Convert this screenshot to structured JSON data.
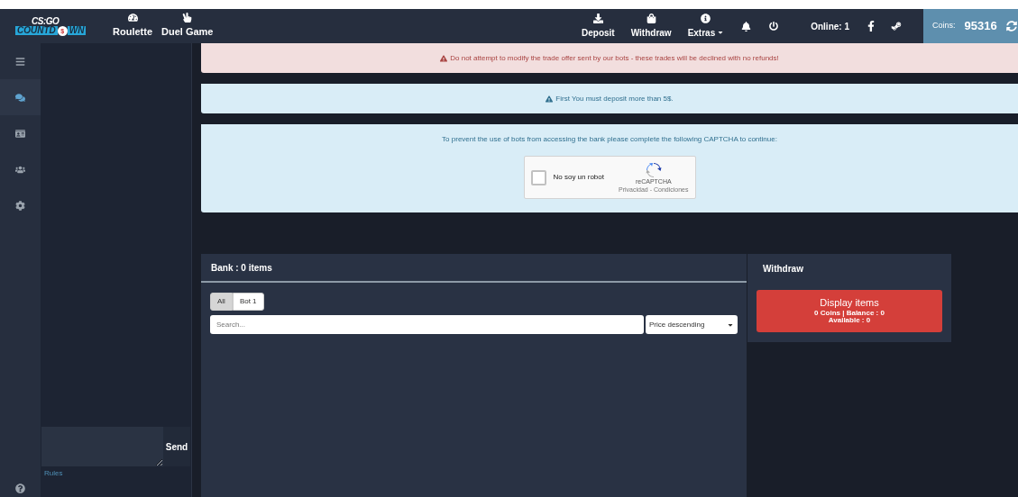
{
  "logo": {
    "top": "CS:GO",
    "left": "COUNTD",
    "coin": "$",
    "right": "WN"
  },
  "nav_left": [
    {
      "label": "Roulette"
    },
    {
      "label": "Duel Game"
    }
  ],
  "nav_right": [
    {
      "label": "Deposit"
    },
    {
      "label": "Withdraw"
    },
    {
      "label": "Extras",
      "dropdown": true
    }
  ],
  "online": {
    "label": "Online:",
    "count": "1"
  },
  "coins": {
    "label": "Coins:",
    "value": "95316"
  },
  "rail": [
    {
      "selected": false
    },
    {
      "selected": true
    },
    {
      "selected": false
    },
    {
      "selected": false
    },
    {
      "selected": false
    }
  ],
  "chat": {
    "send": "Send",
    "rules": "Rules"
  },
  "alerts": [
    {
      "kind": "danger",
      "text": "Do not attempt to modify the trade offer sent by our bots - these trades will be declined with no refunds!"
    },
    {
      "kind": "info",
      "text": "First You must deposit more than 5$."
    }
  ],
  "captcha": {
    "prompt": "To prevent the use of bots from accessing the bank please complete the following CAPTCHA to continue:",
    "checkbox": "No soy un robot",
    "checked": false,
    "brand": "reCAPTCHA",
    "links": "Privacidad - Condiciones"
  },
  "bank": {
    "title": "Bank : 0 items",
    "filters": [
      {
        "label": "All",
        "selected": true
      },
      {
        "label": "Bot 1",
        "selected": false
      }
    ],
    "search_placeholder": "Search...",
    "sort": "Price descending"
  },
  "withdraw": {
    "title": "Withdraw",
    "button": "Display items",
    "line1": "0 Coins | Balance : 0",
    "line2": "Available : 0"
  }
}
